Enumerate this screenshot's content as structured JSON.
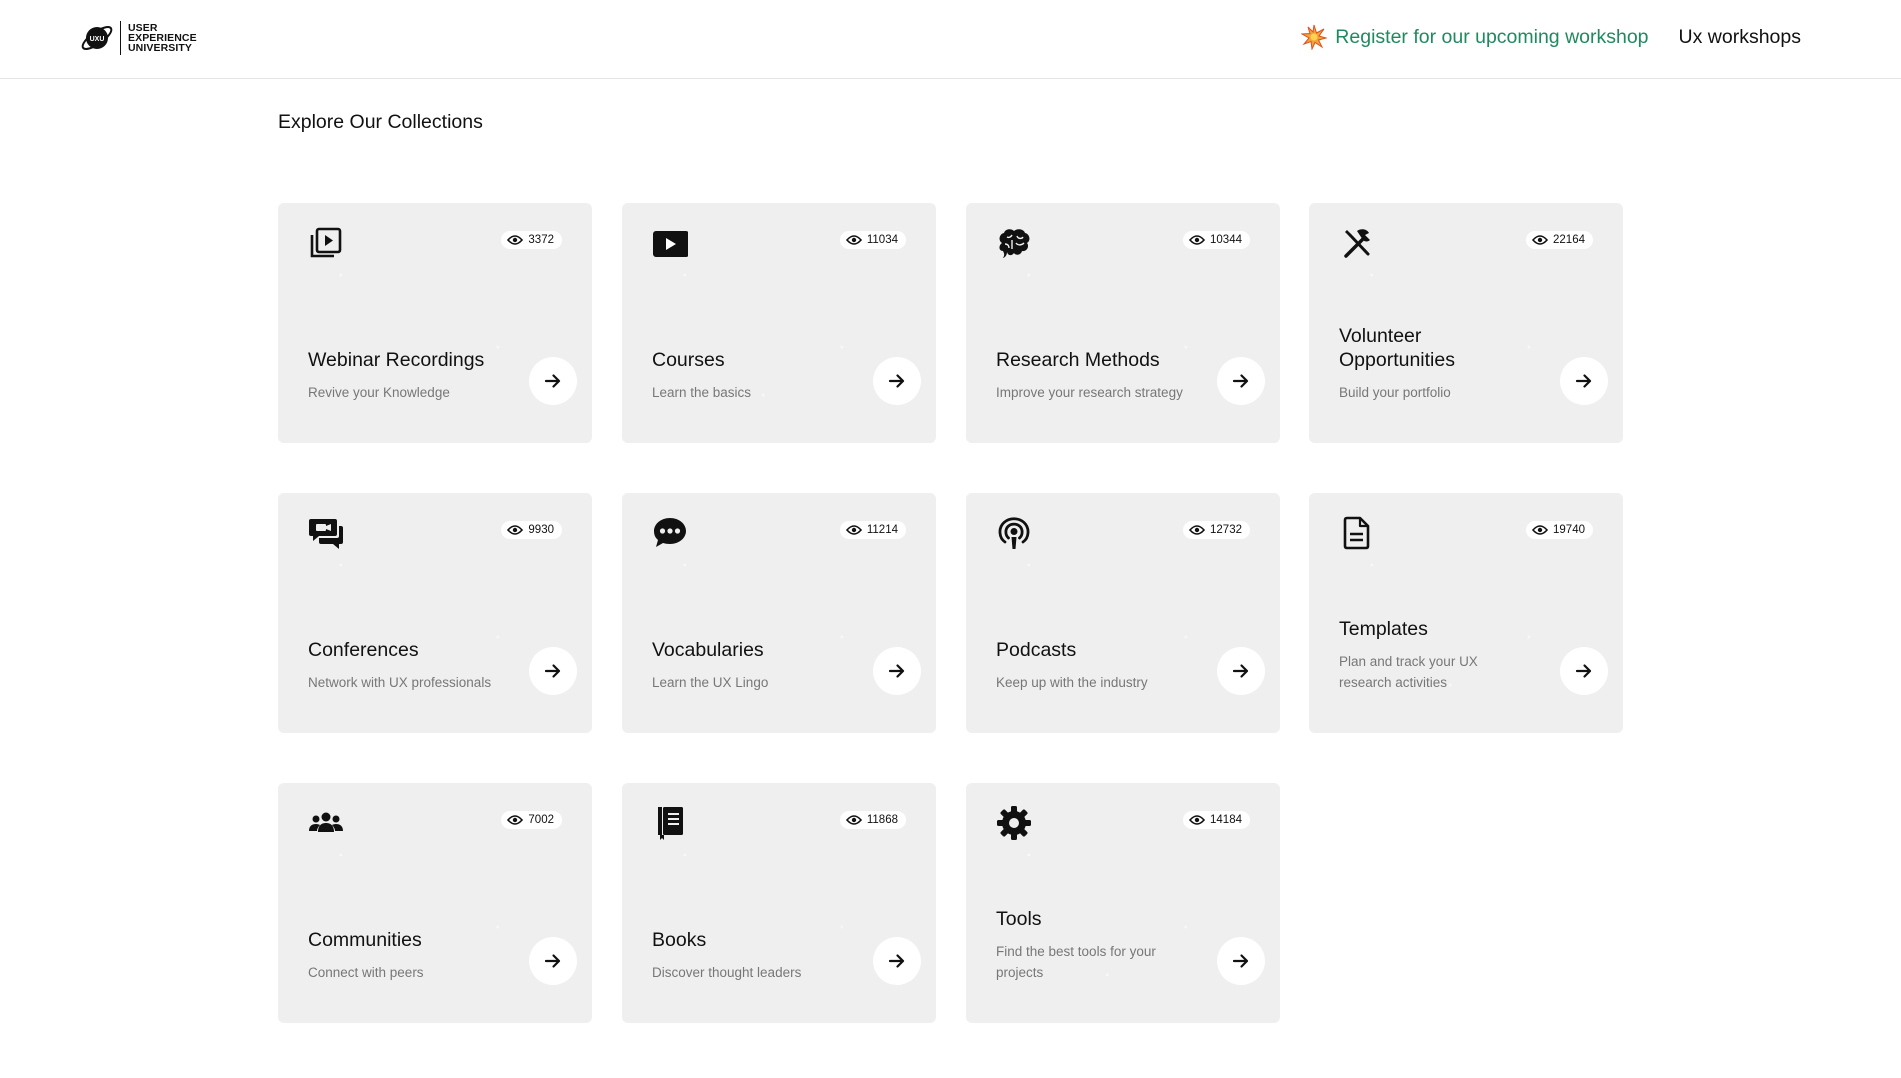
{
  "header": {
    "logo": {
      "line1": "USER",
      "line2": "EXPERIENCE",
      "line3": "UNIVERSITY",
      "mark_text": "UXU"
    },
    "register_label": "Register for our upcoming workshop",
    "register_icon": "spark-icon",
    "workshops_label": "Ux workshops"
  },
  "section_title": "Explore Our Collections",
  "colors": {
    "accent_green": "#1f8a5f",
    "card_bg": "#efefef",
    "muted_text": "#777777"
  },
  "cards": [
    {
      "icon": "video-library-icon",
      "views": "3372",
      "title": "Webinar Recordings",
      "subtitle": "Revive your Knowledge"
    },
    {
      "icon": "play-icon",
      "views": "11034",
      "title": "Courses",
      "subtitle": "Learn the basics"
    },
    {
      "icon": "brain-icon",
      "views": "10344",
      "title": "Research Methods",
      "subtitle": "Improve your research strategy"
    },
    {
      "icon": "tools-icon",
      "views": "22164",
      "title": "Volunteer Opportunities",
      "subtitle": "Build your portfolio"
    },
    {
      "icon": "video-chat-icon",
      "views": "9930",
      "title": "Conferences",
      "subtitle": "Network with UX professionals"
    },
    {
      "icon": "chat-bubble-icon",
      "views": "11214",
      "title": "Vocabularies",
      "subtitle": "Learn the UX Lingo"
    },
    {
      "icon": "podcast-icon",
      "views": "12732",
      "title": "Podcasts",
      "subtitle": "Keep up with the industry"
    },
    {
      "icon": "document-icon",
      "views": "19740",
      "title": "Templates",
      "subtitle": "Plan and track your UX research activities"
    },
    {
      "icon": "people-icon",
      "views": "7002",
      "title": "Communities",
      "subtitle": "Connect with peers"
    },
    {
      "icon": "book-icon",
      "views": "11868",
      "title": "Books",
      "subtitle": "Discover thought leaders"
    },
    {
      "icon": "gear-icon",
      "views": "14184",
      "title": "Tools",
      "subtitle": "Find the best tools for your projects"
    }
  ]
}
